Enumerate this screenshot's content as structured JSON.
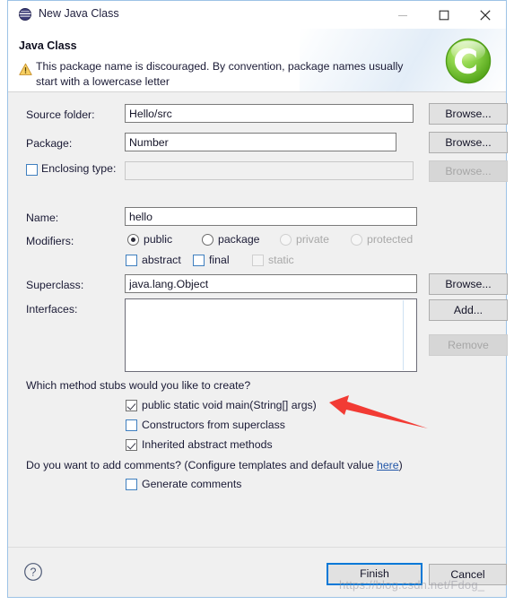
{
  "window": {
    "title": "New Java Class",
    "icon": "java-class-icon",
    "controls": {
      "minimize": "minimize-icon",
      "maximize": "maximize-icon",
      "close": "close-icon"
    }
  },
  "header": {
    "title": "Java Class",
    "warning_icon": "warning-triangle-icon",
    "message": "This package name is discouraged. By convention, package names usually start with a lowercase letter",
    "logo": "green-c-logo",
    "warning_color": "#f2c03a"
  },
  "form": {
    "source_folder": {
      "label": "Source folder:",
      "value": "Hello/src",
      "browse_label": "Browse...",
      "enabled": true
    },
    "package": {
      "label": "Package:",
      "value": "Number",
      "browse_label": "Browse...",
      "enabled": true
    },
    "enclosing_type": {
      "label": "Enclosing type:",
      "checked": false,
      "value": "",
      "browse_label": "Browse...",
      "enabled": false
    },
    "name": {
      "label": "Name:",
      "value": "hello"
    },
    "modifiers": {
      "label": "Modifiers:",
      "access": [
        {
          "label": "public",
          "selected": true,
          "enabled": true
        },
        {
          "label": "package",
          "selected": false,
          "enabled": true
        },
        {
          "label": "private",
          "selected": false,
          "enabled": false
        },
        {
          "label": "protected",
          "selected": false,
          "enabled": false
        }
      ],
      "flags": [
        {
          "label": "abstract",
          "checked": false,
          "enabled": true
        },
        {
          "label": "final",
          "checked": false,
          "enabled": true
        },
        {
          "label": "static",
          "checked": false,
          "enabled": false
        }
      ]
    },
    "superclass": {
      "label": "Superclass:",
      "value": "java.lang.Object",
      "browse_label": "Browse..."
    },
    "interfaces": {
      "label": "Interfaces:",
      "items": [],
      "add_label": "Add...",
      "remove_label": "Remove",
      "remove_enabled": false
    }
  },
  "stubs": {
    "question": "Which method stubs would you like to create?",
    "options": [
      {
        "label": "public static void main(String[] args)",
        "checked": true
      },
      {
        "label": "Constructors from superclass",
        "checked": false
      },
      {
        "label": "Inherited abstract methods",
        "checked": true
      }
    ]
  },
  "comments": {
    "question_before": "Do you want to add comments? (Configure templates and default value ",
    "link_label": "here",
    "question_after": ")",
    "generate": {
      "label": "Generate comments",
      "checked": false
    }
  },
  "footer": {
    "help_icon": "help-question-icon",
    "finish_label": "Finish",
    "cancel_label": "Cancel",
    "focus_color": "#0078d7"
  },
  "annotation": {
    "arrow_color": "#f23b34",
    "points_at": "public static void main(String[] args)"
  },
  "watermark": {
    "text": "https://blog.csdn.net/Fdog_"
  }
}
